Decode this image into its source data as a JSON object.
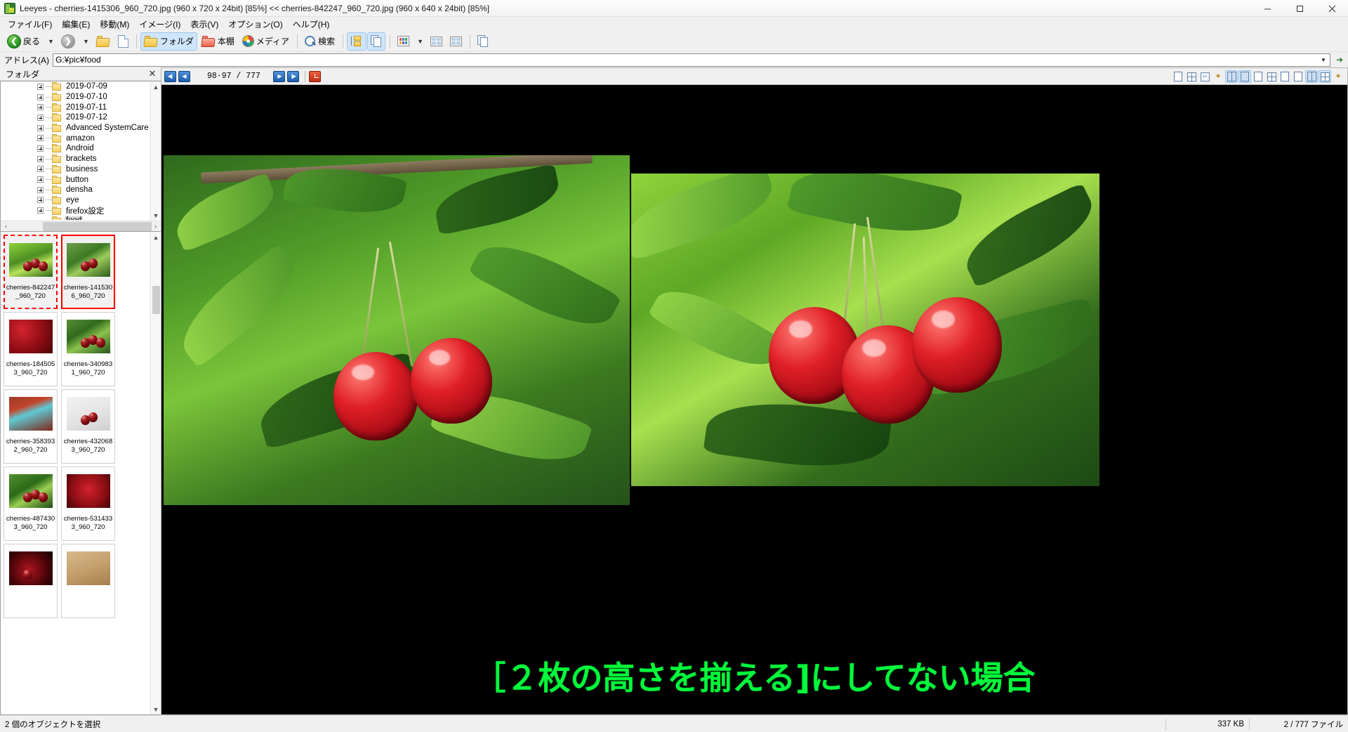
{
  "window": {
    "title": "Leeyes - cherries-1415306_960_720.jpg (960 x 720 x 24bit) [85%]   <<   cherries-842247_960_720.jpg (960 x 640 x 24bit) [85%]",
    "app_icon": "leeyes-app-icon",
    "minimize": "—",
    "maximize": "❐",
    "close": "✕"
  },
  "menu": {
    "items": [
      {
        "label": "ファイル(F)"
      },
      {
        "label": "編集(E)"
      },
      {
        "label": "移動(M)"
      },
      {
        "label": "イメージ(I)"
      },
      {
        "label": "表示(V)"
      },
      {
        "label": "オプション(O)"
      },
      {
        "label": "ヘルプ(H)"
      }
    ]
  },
  "toolbar": {
    "back_label": "戻る",
    "back_caret": "▼",
    "forward_caret": "▼",
    "up_icon": "folder-up-icon",
    "refresh_icon": "refresh-icon",
    "folder_label": "フォルダ",
    "bookshelf_label": "本棚",
    "media_label": "メディア",
    "search_label": "検索",
    "tree_icon": "folder-tree-icon",
    "copy_icon": "duplicate-pages-icon",
    "view_icon": "view-mode-icon",
    "view_caret": "▼",
    "detail_icon": "detail-view-icon",
    "split_icon": "split-view-icon",
    "props_icon": "properties-icon"
  },
  "address": {
    "label": "アドレス(A)",
    "value": "G:¥pic¥food",
    "placeholder": "G:¥pic¥food",
    "caret": "▼",
    "go": "➜"
  },
  "folder_panel": {
    "title": "フォルダ",
    "close": "✕",
    "items": [
      {
        "label": "2019-07-09",
        "expandable": true,
        "selected": false
      },
      {
        "label": "2019-07-10",
        "expandable": true,
        "selected": false
      },
      {
        "label": "2019-07-11",
        "expandable": true,
        "selected": false
      },
      {
        "label": "2019-07-12",
        "expandable": true,
        "selected": false
      },
      {
        "label": "Advanced SystemCare",
        "expandable": true,
        "selected": false
      },
      {
        "label": "amazon",
        "expandable": true,
        "selected": false
      },
      {
        "label": "Android",
        "expandable": true,
        "selected": false
      },
      {
        "label": "brackets",
        "expandable": true,
        "selected": false
      },
      {
        "label": "business",
        "expandable": true,
        "selected": false
      },
      {
        "label": "button",
        "expandable": true,
        "selected": false
      },
      {
        "label": "densha",
        "expandable": true,
        "selected": false
      },
      {
        "label": "eye",
        "expandable": true,
        "selected": false
      },
      {
        "label": "firefox設定",
        "expandable": true,
        "selected": false
      },
      {
        "label": "food",
        "expandable": false,
        "selected": true
      }
    ],
    "hscroll_left": "‹",
    "hscroll_right": "›",
    "vscroll_up": "▲",
    "vscroll_down": "▼"
  },
  "thumbnails": {
    "items": [
      {
        "caption": "cherries-842247_960_720",
        "state": "focus",
        "art": "v2"
      },
      {
        "caption": "cherries-1415306_960_720",
        "state": "sel",
        "art": "v1"
      },
      {
        "caption": "cherries-1845053_960_720",
        "state": "",
        "art": "pile"
      },
      {
        "caption": "cherries-3409831_960_720",
        "state": "",
        "art": "v3"
      },
      {
        "caption": "cherries-3583932_960_720",
        "state": "",
        "art": "bowl"
      },
      {
        "caption": "cherries-4320683_960_720",
        "state": "",
        "art": "white"
      },
      {
        "caption": "cherries-4874303_960_720",
        "state": "",
        "art": "v4"
      },
      {
        "caption": "cherries-5314333_960_720",
        "state": "",
        "art": "basket"
      },
      {
        "caption": "",
        "state": "",
        "art": "dark"
      },
      {
        "caption": "",
        "state": "",
        "art": "nuts"
      }
    ],
    "vscroll_up": "▲",
    "vscroll_down": "▼"
  },
  "viewer": {
    "close_tab": "✕",
    "first_label": "◀|",
    "prev_label": "◀",
    "counter": "98·97 / 777",
    "next_label": "▶",
    "last_label": "|▶",
    "slideshow_icon": "slideshow-clock-icon",
    "right_icons": [
      {
        "name": "fit-window-icon",
        "glyph": "doc",
        "on": false
      },
      {
        "name": "grid-view-icon",
        "glyph": "grid",
        "on": false
      },
      {
        "name": "rotate-icon",
        "glyph": "arrow",
        "on": false
      },
      {
        "name": "flip-icon",
        "glyph": "star",
        "on": false
      },
      {
        "name": "two-page-spread-icon",
        "glyph": "dual",
        "on": true
      },
      {
        "name": "single-page-icon",
        "glyph": "doc",
        "on": true
      },
      {
        "name": "zoom-fit-icon",
        "glyph": "doc",
        "on": false
      },
      {
        "name": "zoom-actual-icon",
        "glyph": "grid",
        "on": false
      },
      {
        "name": "page-left-icon",
        "glyph": "doc",
        "on": false
      },
      {
        "name": "page-right-icon",
        "glyph": "doc",
        "on": false
      },
      {
        "name": "align-pages-icon",
        "glyph": "dual",
        "on": true
      },
      {
        "name": "thumbnail-strip-icon",
        "glyph": "grid",
        "on": true
      },
      {
        "name": "settings-icon",
        "glyph": "star",
        "on": false
      }
    ],
    "caption_overlay": "［２枚の高さを揃える]にしてない場合"
  },
  "statusbar": {
    "selection": "2 個のオブジェクトを選択",
    "size": "337 KB",
    "count": "2 / 777 ファイル"
  },
  "colors": {
    "accent": "#cfe5fb",
    "selection_red": "#ff0000",
    "caption_green": "#00ff3b",
    "titlebar": "#fdfdfd",
    "chrome": "#f0f0f0"
  }
}
